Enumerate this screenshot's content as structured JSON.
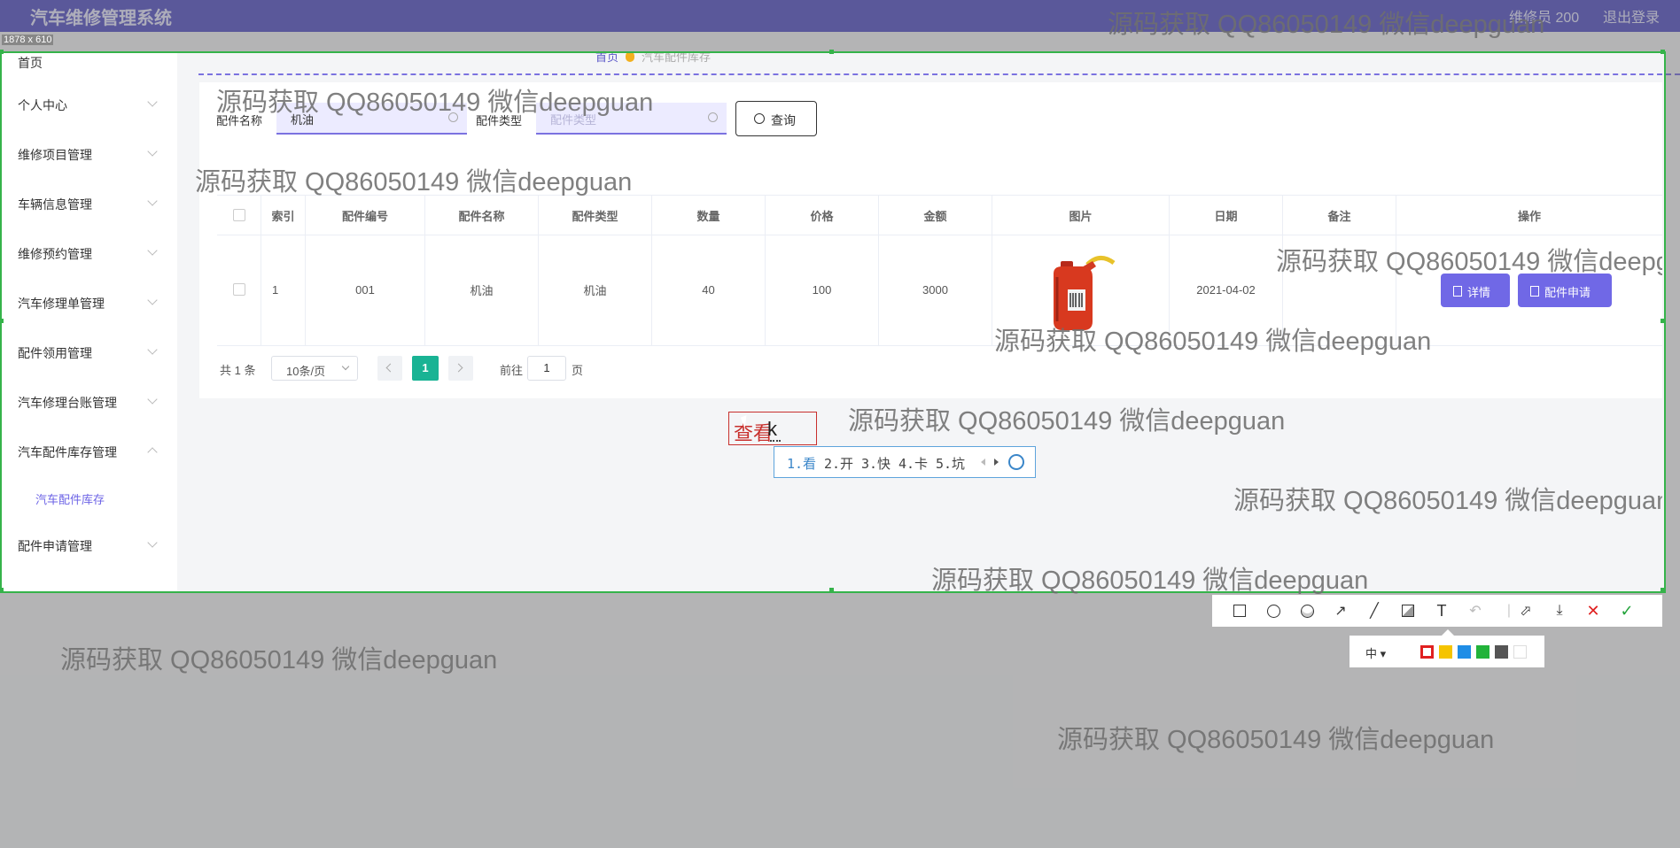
{
  "app": {
    "title": "汽车维修管理系统",
    "user": "维修员 200",
    "logout": "退出登录"
  },
  "screenshot_dims": "1878 x 610",
  "sidebar": {
    "items": [
      {
        "label": "首页"
      },
      {
        "label": "个人中心"
      },
      {
        "label": "维修项目管理"
      },
      {
        "label": "车辆信息管理"
      },
      {
        "label": "维修预约管理"
      },
      {
        "label": "汽车修理单管理"
      },
      {
        "label": "配件领用管理"
      },
      {
        "label": "汽车修理台账管理"
      },
      {
        "label": "汽车配件库存管理"
      },
      {
        "label": "汽车配件库存"
      },
      {
        "label": "配件申请管理"
      }
    ]
  },
  "breadcrumb": {
    "home": "首页",
    "current": "汽车配件库存"
  },
  "search": {
    "name_label": "配件名称",
    "name_value": "机油",
    "type_label": "配件类型",
    "type_placeholder": "配件类型",
    "query_label": "查询"
  },
  "table": {
    "headers": [
      "索引",
      "配件编号",
      "配件名称",
      "配件类型",
      "数量",
      "价格",
      "金额",
      "图片",
      "日期",
      "备注",
      "操作"
    ],
    "rows": [
      {
        "index": "1",
        "code": "001",
        "name": "机油",
        "type": "机油",
        "qty": "40",
        "price": "100",
        "amount": "3000",
        "date": "2021-04-02",
        "note": ""
      }
    ],
    "actions": {
      "detail": "详情",
      "apply": "配件申请"
    }
  },
  "pagination": {
    "total": "共 1 条",
    "page_size": "10条/页",
    "current": "1",
    "goto_prefix": "前往",
    "goto_value": "1",
    "goto_suffix": "页"
  },
  "annotation": {
    "red_text": "查看",
    "typed": "k"
  },
  "ime": {
    "candidates": [
      "1.看",
      "2.开",
      "3.快",
      "4.卡",
      "5.坑"
    ]
  },
  "screenshot_tool": {
    "size_label": "中",
    "colors": [
      "#e02020",
      "#f5c400",
      "#1f8de6",
      "#22b33a",
      "#555555",
      "#ffffff"
    ]
  },
  "watermark": "源码获取 QQ86050149 微信deepguan"
}
